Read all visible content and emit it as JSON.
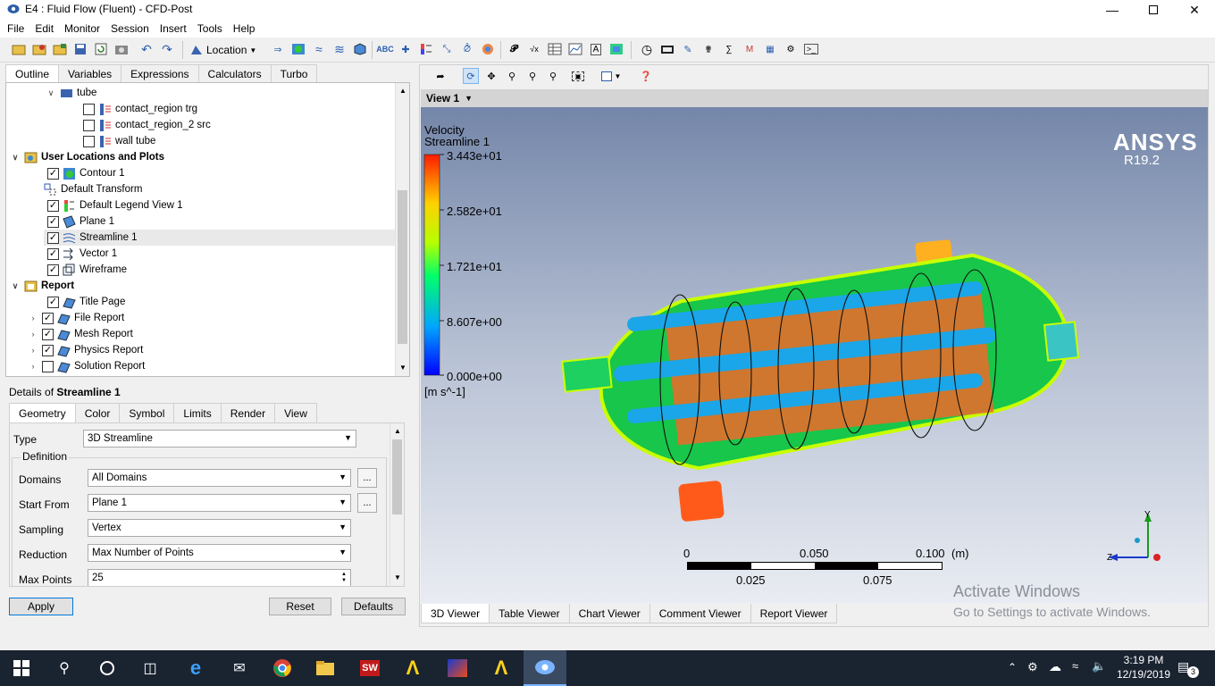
{
  "window": {
    "title": "E4 : Fluid Flow (Fluent) - CFD-Post"
  },
  "menu": [
    "File",
    "Edit",
    "Monitor",
    "Session",
    "Insert",
    "Tools",
    "Help"
  ],
  "toolbar": {
    "location_label": "Location"
  },
  "left_tabs": [
    "Outline",
    "Variables",
    "Expressions",
    "Calculators",
    "Turbo"
  ],
  "tree": {
    "tube": "tube",
    "contact_trg": "contact_region trg",
    "contact_src": "contact_region_2 src",
    "wall_tube": "wall tube",
    "user_locations": "User Locations and Plots",
    "contour1": "Contour 1",
    "default_transform": "Default Transform",
    "legend": "Default Legend View 1",
    "plane1": "Plane 1",
    "streamline1": "Streamline 1",
    "vector1": "Vector 1",
    "wireframe": "Wireframe",
    "report": "Report",
    "title_page": "Title Page",
    "file_report": "File Report",
    "mesh_report": "Mesh Report",
    "physics_report": "Physics Report",
    "solution_report": "Solution Report"
  },
  "details": {
    "prefix": "Details of ",
    "object": "Streamline 1",
    "tabs": [
      "Geometry",
      "Color",
      "Symbol",
      "Limits",
      "Render",
      "View"
    ],
    "type_label": "Type",
    "type_value": "3D Streamline",
    "definition": "Definition",
    "domains_label": "Domains",
    "domains_value": "All Domains",
    "start_label": "Start From",
    "start_value": "Plane 1",
    "sampling_label": "Sampling",
    "sampling_value": "Vertex",
    "reduction_label": "Reduction",
    "reduction_value": "Max Number of Points",
    "maxpoints_label": "Max Points",
    "maxpoints_value": "25",
    "dots": "..."
  },
  "buttons": {
    "apply": "Apply",
    "reset": "Reset",
    "defaults": "Defaults"
  },
  "viewer": {
    "view_name": "View 1",
    "legend_var": "Velocity",
    "legend_obj": "Streamline 1",
    "legend_ticks": [
      "3.443e+01",
      "2.582e+01",
      "1.721e+01",
      "8.607e+00",
      "0.000e+00"
    ],
    "legend_unit": "[m s^-1]",
    "brand": "ANSYS",
    "version": "R19.2",
    "scale_top": [
      "0",
      "0.050",
      "0.100"
    ],
    "scale_unit": "(m)",
    "scale_bottom": [
      "0.025",
      "0.075"
    ],
    "axis_y": "Y",
    "axis_z": "Z",
    "watermark1": "Activate Windows",
    "watermark2": "Go to Settings to activate Windows."
  },
  "bottom_tabs": [
    "3D Viewer",
    "Table Viewer",
    "Chart Viewer",
    "Comment Viewer",
    "Report Viewer"
  ],
  "taskbar": {
    "time": "3:19 PM",
    "date": "12/19/2019",
    "notif": "3"
  },
  "colors": {
    "accent": "#0078d7",
    "taskbar": "#1a2330",
    "sky_top": "#7486a9"
  }
}
